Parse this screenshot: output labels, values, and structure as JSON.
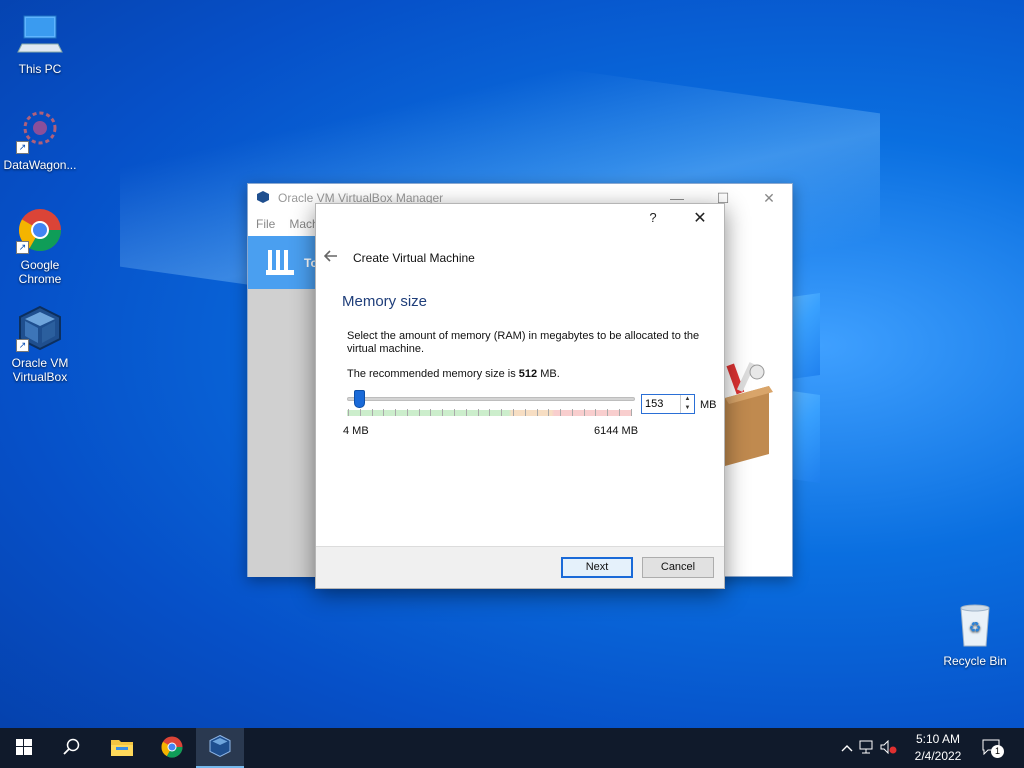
{
  "desktop": {
    "icons": [
      {
        "label": "This PC"
      },
      {
        "label": "DataWagon..."
      },
      {
        "label": "Google Chrome"
      },
      {
        "label": "Oracle VM VirtualBox"
      },
      {
        "label": "Recycle Bin"
      }
    ]
  },
  "vbox_manager": {
    "title": "Oracle VM VirtualBox Manager",
    "menu": [
      "File",
      "Mach"
    ],
    "tools_label": "To",
    "controls": {
      "minimize": "—",
      "maximize": "☐",
      "close": "✕"
    }
  },
  "dialog": {
    "help": "?",
    "close": "✕",
    "title": "Create Virtual Machine",
    "section_title": "Memory size",
    "description": "Select the amount of memory (RAM) in megabytes to be allocated to the virtual machine.",
    "recommended_prefix": "The recommended memory size is ",
    "recommended_value": "512",
    "recommended_suffix": " MB.",
    "memory_value": "153",
    "memory_min_mb": 4,
    "memory_max_mb": 6144,
    "min_label": "4 MB",
    "max_label": "6144 MB",
    "unit": "MB",
    "next_label": "Next",
    "cancel_label": "Cancel"
  },
  "taskbar": {
    "clock_time": "5:10 AM",
    "clock_date": "2/4/2022",
    "notification_count": "1"
  },
  "colors": {
    "accent": "#1a6ad8",
    "taskbar": "#101a2b",
    "section_title": "#1f3e7a"
  }
}
